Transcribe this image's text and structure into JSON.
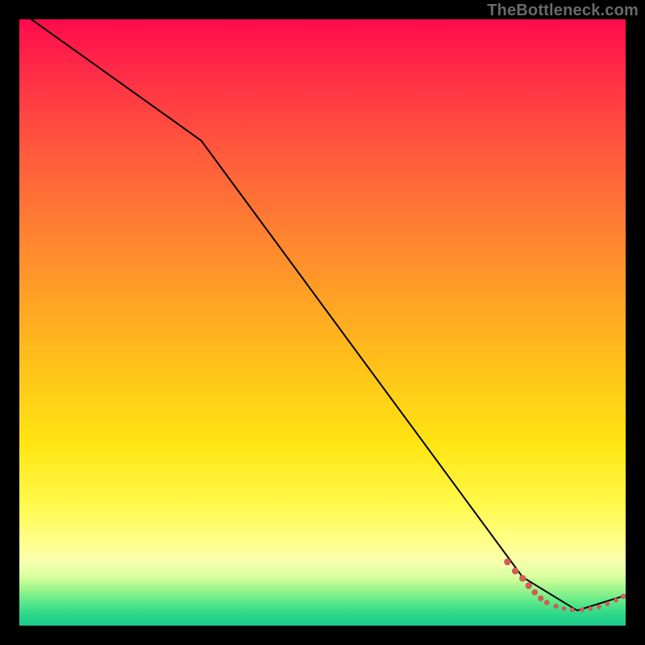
{
  "watermark": "TheBottleneck.com",
  "chart_data": {
    "type": "line",
    "title": "",
    "xlabel": "",
    "ylabel": "",
    "xlim": [
      0,
      100
    ],
    "ylim": [
      0,
      100
    ],
    "grid": false,
    "series": [
      {
        "name": "curve",
        "style": "solid-black",
        "x": [
          2,
          30,
          83,
          92,
          100
        ],
        "y": [
          100,
          80,
          8,
          2.5,
          5
        ]
      }
    ],
    "markers": {
      "name": "tail-dots",
      "color": "#cf5d56",
      "points": [
        {
          "x": 80.5,
          "y": 10.5,
          "r": 3.2
        },
        {
          "x": 81.8,
          "y": 9.0,
          "r": 3.2
        },
        {
          "x": 83.0,
          "y": 7.8,
          "r": 3.2
        },
        {
          "x": 84.0,
          "y": 6.6,
          "r": 3.2
        },
        {
          "x": 85.0,
          "y": 5.5,
          "r": 3.0
        },
        {
          "x": 86.0,
          "y": 4.5,
          "r": 2.8
        },
        {
          "x": 87.0,
          "y": 3.8,
          "r": 2.6
        },
        {
          "x": 88.5,
          "y": 3.2,
          "r": 2.4
        },
        {
          "x": 89.8,
          "y": 2.8,
          "r": 2.2
        },
        {
          "x": 91.2,
          "y": 2.6,
          "r": 2.2
        },
        {
          "x": 92.8,
          "y": 2.6,
          "r": 2.2
        },
        {
          "x": 94.2,
          "y": 2.8,
          "r": 2.2
        },
        {
          "x": 95.6,
          "y": 3.1,
          "r": 2.2
        },
        {
          "x": 97.0,
          "y": 3.6,
          "r": 2.2
        },
        {
          "x": 98.4,
          "y": 4.2,
          "r": 2.2
        },
        {
          "x": 99.6,
          "y": 4.8,
          "r": 2.4
        }
      ]
    }
  }
}
